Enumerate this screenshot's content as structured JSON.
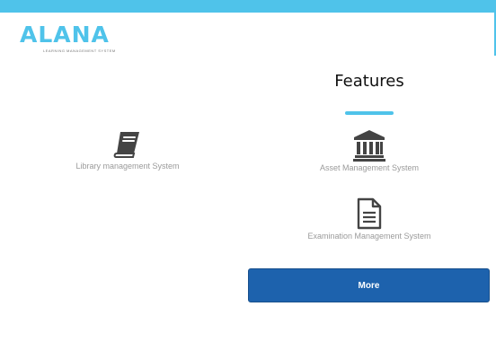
{
  "header": {
    "logo_text": "ALANA",
    "logo_tagline": "LEARNING MANAGEMENT SYSTEM"
  },
  "features": {
    "title": "Features",
    "items": [
      {
        "label": "Library management System",
        "icon": "book-icon"
      },
      {
        "label": "Asset Management System",
        "icon": "bank-icon"
      },
      {
        "label": "Examination Management System",
        "icon": "document-icon"
      }
    ],
    "more_label": "More"
  },
  "colors": {
    "accent": "#4fc3ea",
    "button": "#1d62ad",
    "icon": "#444444"
  }
}
